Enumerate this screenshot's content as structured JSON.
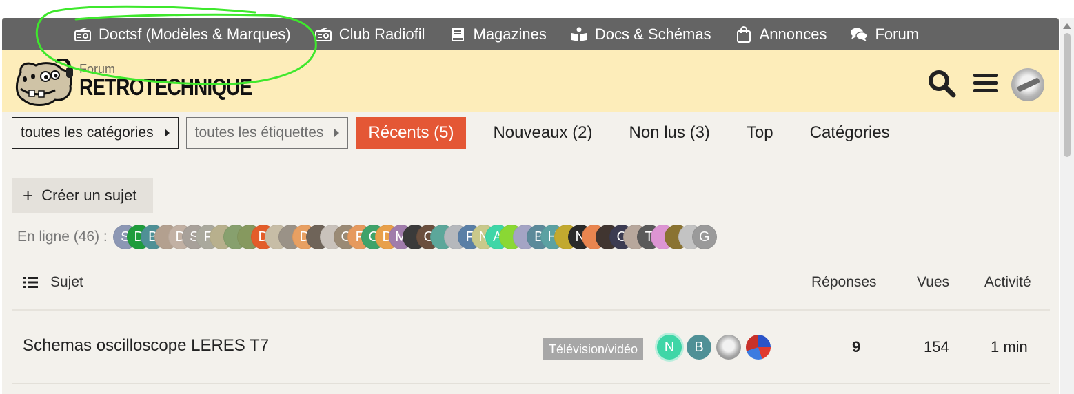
{
  "topnav": {
    "items": [
      {
        "label": "Doctsf (Modèles & Marques)",
        "icon": "radio-icon"
      },
      {
        "label": "Club Radiofil",
        "icon": "radio-icon"
      },
      {
        "label": "Magazines",
        "icon": "book-icon"
      },
      {
        "label": "Docs & Schémas",
        "icon": "reader-icon"
      },
      {
        "label": "Annonces",
        "icon": "shopping-bag-icon"
      },
      {
        "label": "Forum",
        "icon": "comments-icon"
      }
    ]
  },
  "header": {
    "brand_small": "Forum",
    "brand_big": "RETROTECHNIQUE",
    "search_icon": "search-icon",
    "menu_icon": "hamburger-icon"
  },
  "filters": {
    "categories": "toutes les catégories",
    "tags": "toutes les étiquettes",
    "tabs": [
      "Récents (5)",
      "Nouveaux (2)",
      "Non lus (3)",
      "Top",
      "Catégories"
    ]
  },
  "create_topic": "Créer un sujet",
  "online": {
    "label": "En ligne (46) :",
    "avatars": [
      "S",
      "D",
      "B",
      "",
      "D",
      "S",
      "F",
      "",
      "",
      "",
      "D",
      "",
      "",
      "D",
      "",
      "",
      "C",
      "F",
      "C",
      "D",
      "M",
      "",
      "C",
      "",
      "",
      "F",
      "N",
      "A",
      "",
      "",
      "B",
      "H",
      "",
      "N",
      "",
      "",
      "C",
      "",
      "T",
      "",
      "",
      "",
      "G"
    ]
  },
  "list_header": {
    "topic": "Sujet",
    "replies": "Réponses",
    "views": "Vues",
    "activity": "Activité"
  },
  "topics": [
    {
      "title": "Schemas oscilloscope LERES T7",
      "category": "Télévision/vidéo",
      "posters": [
        "N",
        "B",
        "",
        ""
      ],
      "replies": "9",
      "views": "154",
      "activity": "1 min"
    }
  ],
  "colors": {
    "topbar": "#646464",
    "header_bg": "#fdedba",
    "accent": "#e45735",
    "page_bg": "#f3f1ec",
    "annotation": "#3ee82c"
  }
}
